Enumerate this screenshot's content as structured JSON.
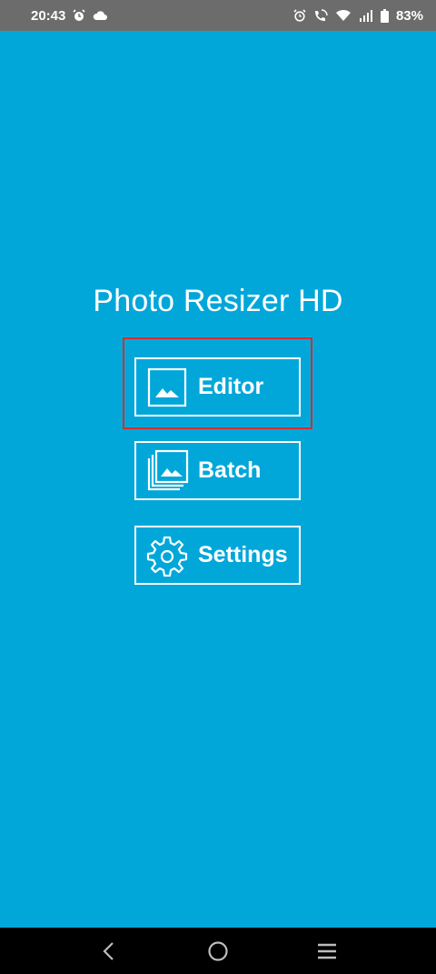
{
  "status_bar": {
    "time": "20:43",
    "battery": "83%",
    "left_icons": [
      "alarm-icon",
      "cloud-icon"
    ],
    "right_icons": [
      "alarm-icon",
      "wifi-call-icon",
      "wifi-icon",
      "signal-icon",
      "battery-icon"
    ]
  },
  "app": {
    "title": "Photo Resizer HD",
    "buttons": [
      {
        "label": "Editor",
        "icon": "image-icon"
      },
      {
        "label": "Batch",
        "icon": "stacked-images-icon"
      },
      {
        "label": "Settings",
        "icon": "gear-icon"
      }
    ]
  },
  "nav_bar": {
    "icons": [
      "back-icon",
      "home-icon",
      "recents-icon"
    ]
  },
  "colors": {
    "background": "#02a7da",
    "status_bar": "#6c6c6c",
    "highlight": "#d32f2f"
  }
}
